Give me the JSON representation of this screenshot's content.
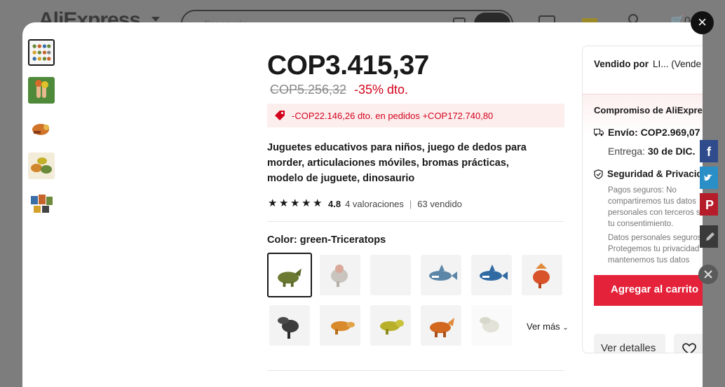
{
  "header": {
    "logo": "AliExpress",
    "search_placeholder": "dinosaurio",
    "cart_count": "0"
  },
  "modal": {
    "close_label": "×"
  },
  "thumbnails": [
    {
      "icon": "dino-set-thumb"
    },
    {
      "icon": "finger-dino-thumb"
    },
    {
      "icon": "dino-head-thumb"
    },
    {
      "icon": "dino-group-thumb"
    },
    {
      "icon": "dino-pack-thumb"
    }
  ],
  "product": {
    "price": "COP3.415,37",
    "old_price": "COP5.256,32",
    "discount": "-35% dto.",
    "coupon": "-COP22.146,26 dto. en pedidos +COP172.740,80",
    "title": "Juguetes educativos para niños, juego de dedos para morder, articulaciones móviles, bromas prácticas, modelo de juguete, dinosaurio",
    "rating_value": "4.8",
    "ratings": "4 valoraciones",
    "sold": "63 vendido",
    "color_label": "Color: green-Triceratops",
    "more_label": "Ver más"
  },
  "swatches": [
    {
      "color": "#6b7a33"
    },
    {
      "color": "#c9c4be"
    },
    {
      "color": ""
    },
    {
      "color": "#5c86a8"
    },
    {
      "color": "#2f6aa3"
    },
    {
      "color": "#d9532a"
    },
    {
      "color": "#3b3b3b"
    },
    {
      "color": "#d88a2c"
    },
    {
      "color": "#b8b02a"
    },
    {
      "color": "#d2681f"
    },
    {
      "color": "#e2e2d8"
    }
  ],
  "panel": {
    "sold_by_label": "Vendido por",
    "sold_by_value": "LI... (Vende",
    "commitment": "Compromiso de AliExpre",
    "shipping": "Envío: COP2.969,07",
    "delivery_label": "Entrega:",
    "delivery_date": "30 de DIC.",
    "security": "Seguridad & Privacid",
    "security_lines": [
      "Pagos seguros: No",
      "compartiremos tus datos",
      "personales con terceros s",
      "tu consentimiento.",
      "Datos personales seguros",
      "Protegemos tu privacidad",
      "mantenemos tus datos"
    ],
    "add_to_cart": "Agregar al carrito",
    "details": "Ver detalles"
  },
  "colors": {
    "accent_red": "#e4223a",
    "price_red": "#d3031c",
    "coupon_bg": "#fdeeee"
  }
}
